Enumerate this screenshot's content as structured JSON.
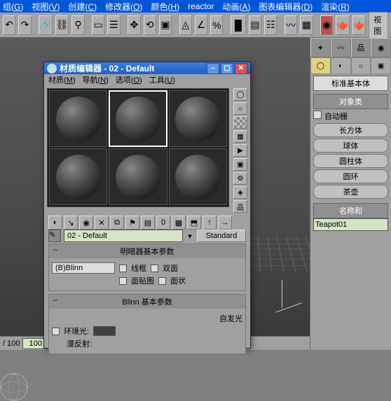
{
  "menubar": {
    "items": [
      {
        "label": "组",
        "key": "G"
      },
      {
        "label": "视图",
        "key": "V"
      },
      {
        "label": "创建",
        "key": "C"
      },
      {
        "label": "修改器",
        "key": "O"
      },
      {
        "label": "颜色",
        "key": "H"
      },
      {
        "label": "reactor",
        "key": ""
      },
      {
        "label": "动画",
        "key": "A"
      },
      {
        "label": "图表编辑器",
        "key": "D"
      },
      {
        "label": "渲染",
        "key": "R"
      }
    ]
  },
  "main_toolbar": {
    "view_label": "视图"
  },
  "command_panel": {
    "dropdown": "标准基本体",
    "sections": {
      "object_type_header": "对象类",
      "autogrid": "自动栅",
      "primitives": [
        "长方体",
        "球体",
        "圆柱体",
        "圆环",
        "茶壶"
      ],
      "name_header": "名称和",
      "object_name": "Teapot01"
    }
  },
  "status": {
    "frame": "/ 100",
    "value": "100"
  },
  "material_editor": {
    "title": "材质编辑器 - 02 - Default",
    "menu": [
      {
        "label": "材质",
        "key": "M"
      },
      {
        "label": "导航",
        "key": "N"
      },
      {
        "label": "选项",
        "key": "O"
      },
      {
        "label": "工具",
        "key": "U"
      }
    ],
    "material_name": "02 - Default",
    "material_type": "Standard",
    "rollout1": {
      "header": "明暗器基本参数",
      "shader": "(B)Blinn",
      "wire": "线框",
      "two_sided": "双面",
      "face_map": "面贴图",
      "faceted": "面状"
    },
    "rollout2": {
      "header": "Blinn 基本参数",
      "self_illum": "自发光",
      "ambient": "环境光:",
      "diffuse": "漫反射:"
    }
  }
}
